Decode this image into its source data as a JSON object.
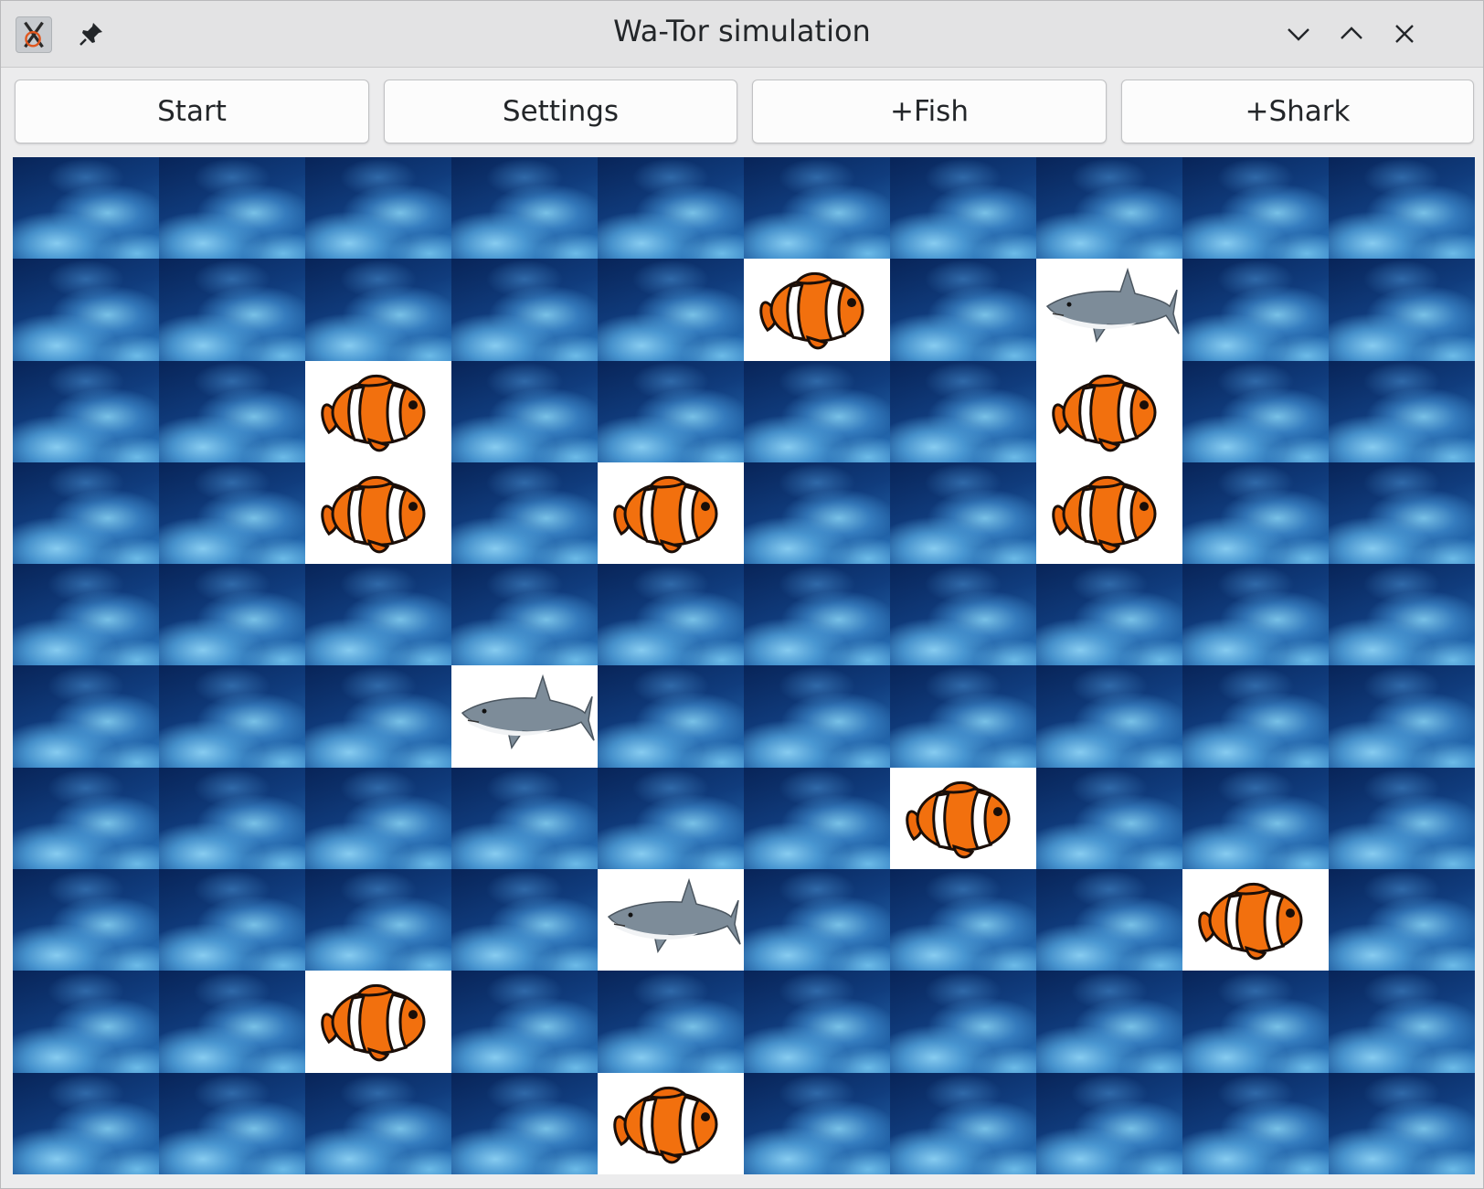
{
  "window": {
    "title": "Wa-Tor simulation",
    "icons": [
      "app-icon",
      "pin-icon",
      "minimize-icon",
      "maximize-icon",
      "close-icon"
    ]
  },
  "toolbar": {
    "start_label": "Start",
    "settings_label": "Settings",
    "add_fish_label": "+Fish",
    "add_shark_label": "+Shark"
  },
  "grid": {
    "rows": 10,
    "cols": 10,
    "cells": [
      "..........",
      ".....F.S..",
      "..F....F..",
      "..F.F..F..",
      "..........",
      "...S......",
      "......F...",
      "....S...F.",
      "..F.......",
      "....F....."
    ],
    "legend": {
      ".": "water",
      "F": "clownfish",
      "S": "shark"
    }
  },
  "colors": {
    "title_text": "#232629",
    "water_dark": "#0d2e66",
    "water_light": "#7fc7ef",
    "fish_orange": "#f06a0a",
    "animal_bg": "#ffffff"
  }
}
